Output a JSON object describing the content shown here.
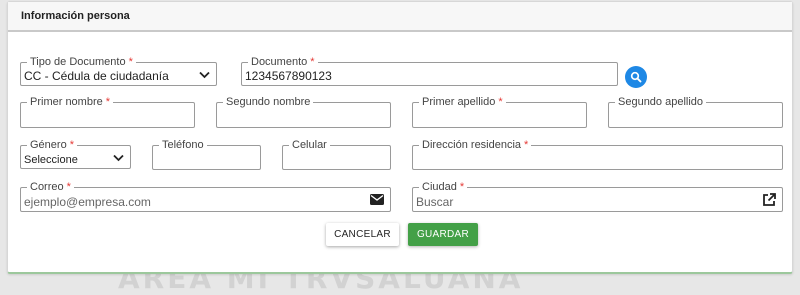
{
  "watermark_text": "AREA MI TRVSALUANA",
  "card": {
    "title": "Información persona"
  },
  "fields": {
    "tipo_documento": {
      "label": "Tipo de Documento",
      "required": "*",
      "value": "CC - Cédula de ciudadanía"
    },
    "documento": {
      "label": "Documento",
      "required": "*",
      "value": "1234567890123"
    },
    "primer_nombre": {
      "label": "Primer nombre",
      "required": "*",
      "value": ""
    },
    "segundo_nombre": {
      "label": "Segundo nombre",
      "value": ""
    },
    "primer_apellido": {
      "label": "Primer apellido",
      "required": "*",
      "value": ""
    },
    "segundo_apellido": {
      "label": "Segundo apellido",
      "value": ""
    },
    "genero": {
      "label": "Género",
      "required": "*",
      "value": "Seleccione"
    },
    "telefono": {
      "label": "Teléfono",
      "value": ""
    },
    "celular": {
      "label": "Celular",
      "value": ""
    },
    "direccion": {
      "label": "Dirección residencia",
      "required": "*",
      "value": ""
    },
    "correo": {
      "label": "Correo",
      "required": "*",
      "placeholder": "ejemplo@empresa.com",
      "icon": "envelope-icon"
    },
    "ciudad": {
      "label": "Ciudad",
      "required": "*",
      "placeholder": "Buscar",
      "icon": "open-external-icon"
    }
  },
  "actions": {
    "cancel_label": "CANCELAR",
    "save_label": "GUARDAR"
  },
  "colors": {
    "primary_blue": "#1e88e5",
    "save_green": "#43a047",
    "required_red": "#e53935"
  }
}
